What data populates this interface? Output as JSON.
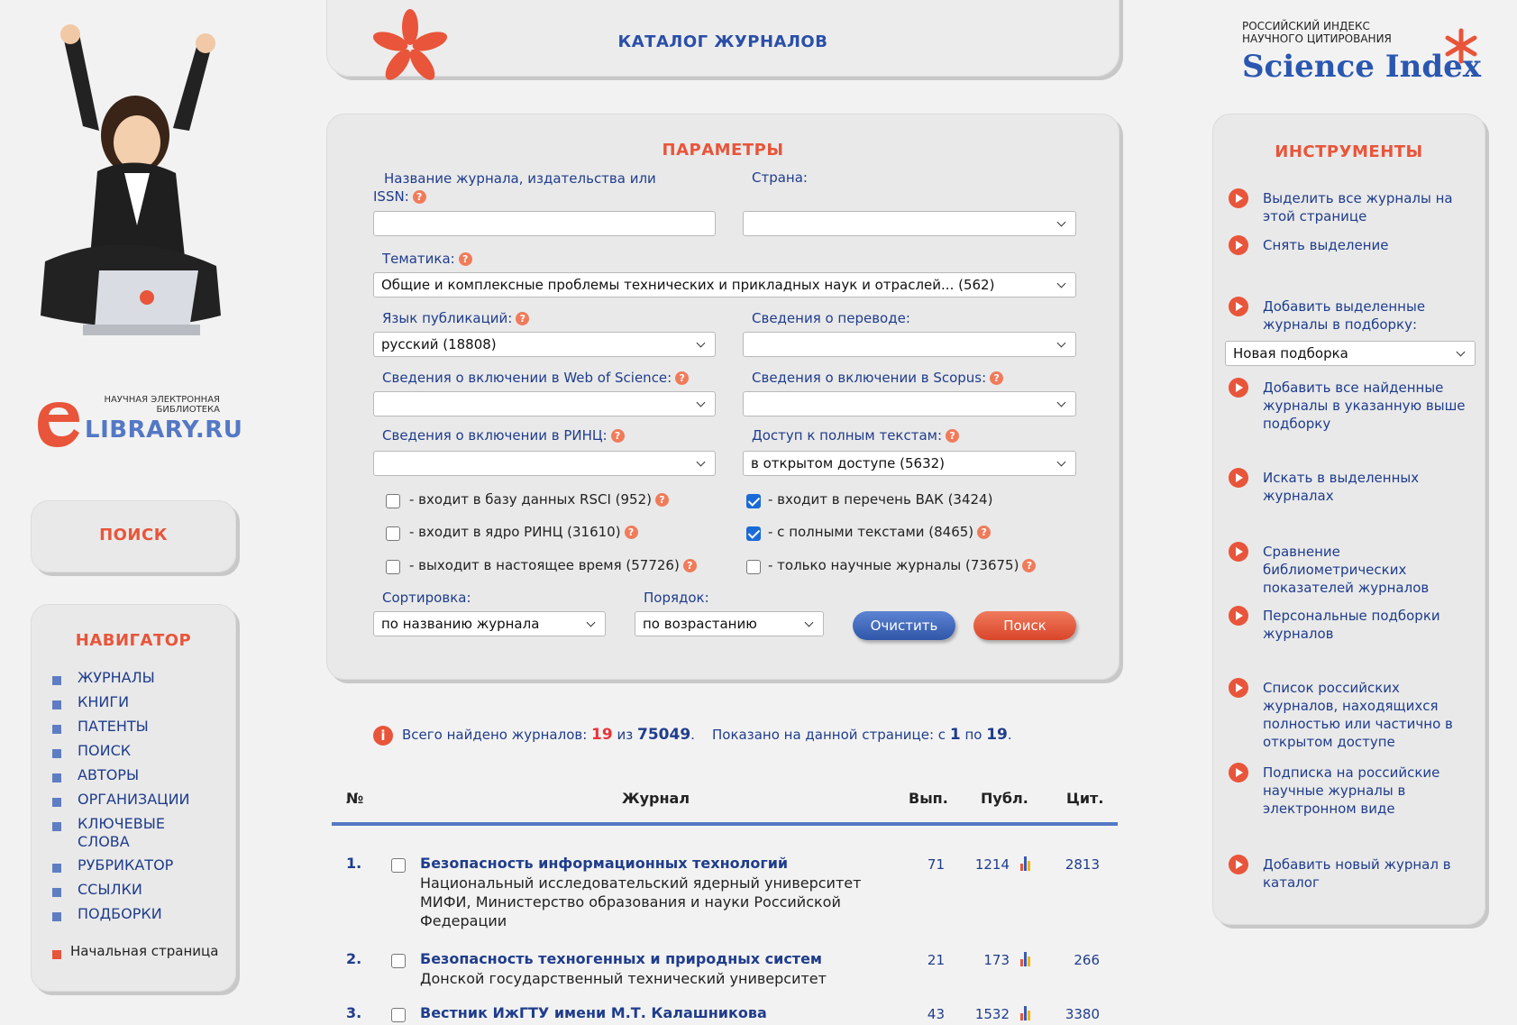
{
  "header": {
    "catalog_title": "КАТАЛОГ ЖУРНАЛОВ",
    "brand_line1": "РОССИЙСКИЙ ИНДЕКС",
    "brand_line2": "НАУЧНОГО ЦИТИРОВАНИЯ",
    "brand_name": "Science Index",
    "elibrary_small1": "НАУЧНАЯ ЭЛЕКТРОННАЯ",
    "elibrary_small2": "БИБЛИОТЕКА",
    "elibrary_name": "LIBRARY.RU"
  },
  "left": {
    "search_label": "ПОИСК",
    "navigator_title": "НАВИГАТОР",
    "nav_items": [
      "ЖУРНАЛЫ",
      "КНИГИ",
      "ПАТЕНТЫ",
      "ПОИСК",
      "АВТОРЫ",
      "ОРГАНИЗАЦИИ",
      "КЛЮЧЕВЫЕ",
      "СЛОВА",
      "РУБРИКАТОР",
      "ССЫЛКИ",
      "ПОДБОРКИ"
    ],
    "home_link": "Начальная страница"
  },
  "params": {
    "title": "ПАРАМЕТРЫ",
    "name_label_1": "Название журнала, издательства или",
    "name_label_2": "ISSN:",
    "name_value": "",
    "country_label": "Страна:",
    "country_value": "",
    "topic_label": "Тематика:",
    "topic_value": "Общие и комплексные проблемы технических и прикладных наук и отраслей...  (562)",
    "lang_label": "Язык публикаций:",
    "lang_value": "русский  (18808)",
    "translation_label": "Сведения о переводе:",
    "translation_value": "",
    "wos_label": "Сведения о включении в Web of Science:",
    "wos_value": "",
    "scopus_label": "Сведения о включении в Scopus:",
    "scopus_value": "",
    "rinc_label": "Сведения о включении в РИНЦ:",
    "rinc_value": "",
    "access_label": "Доступ к полным текстам:",
    "access_value": "в открытом доступе  (5632)",
    "checks": {
      "rsci": "- входит в базу данных RSCI (952)",
      "core": "- входит в ядро РИНЦ (31610)",
      "current": "- выходит в настоящее время (57726)",
      "vak": "- входит в перечень ВАК (3424)",
      "fulltext": "- с полными текстами (8465)",
      "scientific": "- только научные журналы (73675)"
    },
    "sort_label": "Сортировка:",
    "sort_value": "по названию журнала",
    "order_label": "Порядок:",
    "order_value": "по возрастанию",
    "clear_button": "Очистить",
    "search_button": "Поиск"
  },
  "results": {
    "found_prefix": "Всего найдено журналов:",
    "found_count": "19",
    "found_of": "из",
    "found_total": "75049",
    "shown_prefix": "Показано на данной странице: с",
    "shown_from": "1",
    "shown_to_word": "по",
    "shown_to": "19",
    "columns": {
      "num": "№",
      "journal": "Журнал",
      "issues": "Вып.",
      "pubs": "Публ.",
      "cites": "Цит."
    },
    "rows": [
      {
        "num": "1.",
        "title": "Безопасность информационных технологий",
        "sub1": "Национальный исследовательский ядерный университет",
        "sub2": "МИФИ, Министерство образования и науки Российской",
        "sub3": "Федерации",
        "issues": "71",
        "pubs": "1214",
        "cites": "2813"
      },
      {
        "num": "2.",
        "title": "Безопасность техногенных и природных систем",
        "sub1": "Донской государственный технический университет",
        "issues": "21",
        "pubs": "173",
        "cites": "266"
      },
      {
        "num": "3.",
        "title": "Вестник ИжГТУ имени М.Т. Калашникова",
        "issues": "43",
        "pubs": "1532",
        "cites": "3380"
      }
    ]
  },
  "tools": {
    "title": "ИНСТРУМЕНТЫ",
    "t1a": "Выделить все журналы на",
    "t1b": "этой странице",
    "t2": "Снять выделение",
    "t3a": "Добавить выделенные",
    "t3b": "журналы в подборку:",
    "collection_value": "Новая подборка",
    "t4a": "Добавить все найденные",
    "t4b": "журналы в указанную выше",
    "t4c": "подборку",
    "t5a": "Искать в выделенных",
    "t5b": "журналах",
    "t6a": "Сравнение",
    "t6b": "библиометрических",
    "t6c": "показателей журналов",
    "t7a": "Персональные подборки",
    "t7b": "журналов",
    "t8a": "Список российских",
    "t8b": "журналов, находящихся",
    "t8c": "полностью или частично в",
    "t8d": "открытом доступе",
    "t9a": "Подписка на российские",
    "t9b": "научные журналы в",
    "t9c": "электронном виде",
    "t10a": "Добавить новый журнал в",
    "t10b": "каталог"
  },
  "colors": {
    "accent_red": "#e8553a",
    "link_blue": "#1f3d8c",
    "checkbox_blue": "#1a6ad8"
  }
}
